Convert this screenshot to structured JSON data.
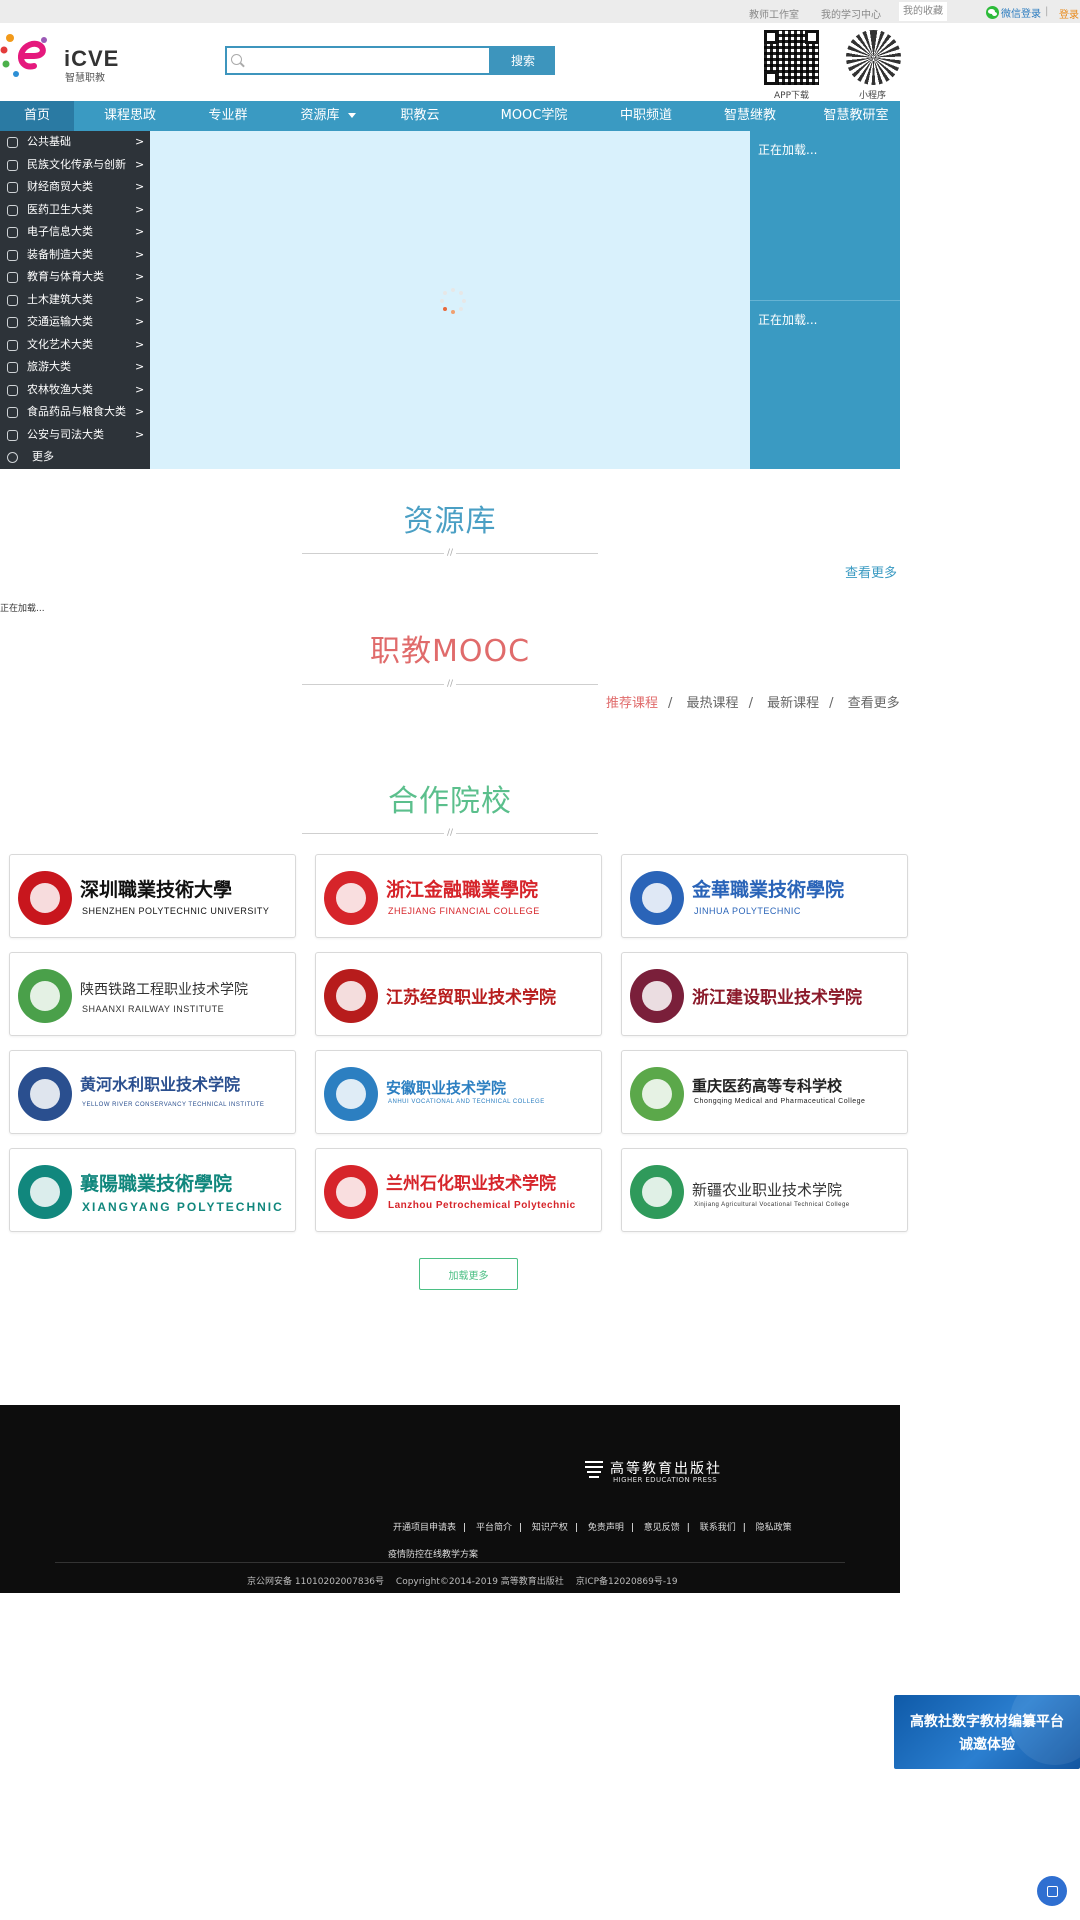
{
  "topbar": {
    "links": [
      "教师工作室",
      "我的学习中心"
    ],
    "favorites": "我的收藏",
    "wechat_login": "微信登录",
    "separator": "|",
    "login": "登录"
  },
  "header": {
    "logo_text": "iCVE",
    "logo_sub": "智慧职教",
    "search": {
      "placeholder": "",
      "button": "搜索"
    },
    "qr": [
      {
        "label": "APP下载"
      },
      {
        "label": "小程序"
      }
    ]
  },
  "nav": {
    "items": [
      "首页",
      "课程思政",
      "专业群",
      "资源库",
      "职教云",
      "MOOC学院",
      "中职频道",
      "智慧继教",
      "智慧教研室"
    ],
    "active": "首页"
  },
  "categories": {
    "items": [
      "公共基础",
      "民族文化传承与创新",
      "财经商贸大类",
      "医药卫生大类",
      "电子信息大类",
      "装备制造大类",
      "教育与体育大类",
      "土木建筑大类",
      "交通运输大类",
      "文化艺术大类",
      "旅游大类",
      "农林牧渔大类",
      "食品药品与粮食大类",
      "公安与司法大类"
    ],
    "arrow": ">",
    "more": "更多"
  },
  "side_news": {
    "loading_top": "正在加载...",
    "loading_bottom": "正在加载..."
  },
  "resource": {
    "title": "资源库",
    "view_more": "查看更多",
    "loading": "正在加载..."
  },
  "mooc": {
    "title": "职教MOOC",
    "tabs": [
      "推荐课程",
      "最热课程",
      "最新课程",
      "查看更多"
    ],
    "tab_separator": "/"
  },
  "partners": {
    "title": "合作院校",
    "schools": [
      {
        "name": "深圳職業技術大學",
        "en": "SHENZHEN POLYTECHNIC UNIVERSITY",
        "color": "#c8161d",
        "text_color": "#111111"
      },
      {
        "name": "浙江金融職業學院",
        "en": "ZHEJIANG FINANCIAL COLLEGE",
        "color": "#d6242a",
        "text_color": "#d6242a"
      },
      {
        "name": "金華職業技術學院",
        "en": "JINHUA POLYTECHNIC",
        "color": "#2a64b8",
        "text_color": "#2a64b8"
      },
      {
        "name": "陕西铁路工程职业技术学院",
        "en": "SHAANXI RAILWAY INSTITUTE",
        "color": "#4aa04a",
        "text_color": "#333333"
      },
      {
        "name": "江苏经贸职业技术学院",
        "en": "",
        "color": "#b71c1c",
        "text_color": "#b71c1c"
      },
      {
        "name": "浙江建设职业技术学院",
        "en": "",
        "color": "#7a1f3a",
        "text_color": "#8b1a2a"
      },
      {
        "name": "黄河水利职业技术学院",
        "en": "YELLOW RIVER CONSERVANCY TECHNICAL INSTITUTE",
        "color": "#2a4f8f",
        "text_color": "#2a4f8f"
      },
      {
        "name": "安徽职业技术学院",
        "en": "ANHUI VOCATIONAL AND TECHNICAL COLLEGE",
        "color": "#2c7fc1",
        "text_color": "#2c7fc1"
      },
      {
        "name": "重庆医药高等专科学校",
        "en": "Chongqing Medical and Pharmaceutical College",
        "color": "#5ba84a",
        "text_color": "#222222"
      },
      {
        "name": "襄陽職業技術學院",
        "en": "XIANGYANG POLYTECHNIC",
        "color": "#11877d",
        "text_color": "#11877d"
      },
      {
        "name": "兰州石化职业技术学院",
        "en": "Lanzhou Petrochemical Polytechnic",
        "color": "#d6242a",
        "text_color": "#d6242a"
      },
      {
        "name": "新疆农业职业技术学院",
        "en": "Xinjiang Agricultural Vocational Technical College",
        "color": "#2f9a5b",
        "text_color": "#333333"
      }
    ],
    "load_more": "加载更多"
  },
  "footer": {
    "press_name": "高等教育出版社",
    "press_en": "HIGHER EDUCATION PRESS",
    "links": [
      "开通项目申请表",
      "平台简介",
      "知识产权",
      "免责声明",
      "意见反馈",
      "联系我们",
      "隐私政策"
    ],
    "link_separator": "|",
    "extra": "疫情防控在线教学方案",
    "copyright": [
      "京公网安备 11010202007836号",
      "Copyright©2014-2019 高等教育出版社",
      "京ICP备12020869号-19"
    ]
  },
  "float_banner": {
    "line1": "高教社数字教材编纂平台",
    "line2": "诚邀体验"
  },
  "colors": {
    "primary": "#3a9ac2",
    "nav_active": "#2a7aa3",
    "sidebar": "#2d3339",
    "banner": "#d9f1fc",
    "mooc": "#e06b6b",
    "partners": "#5bbf8c"
  }
}
